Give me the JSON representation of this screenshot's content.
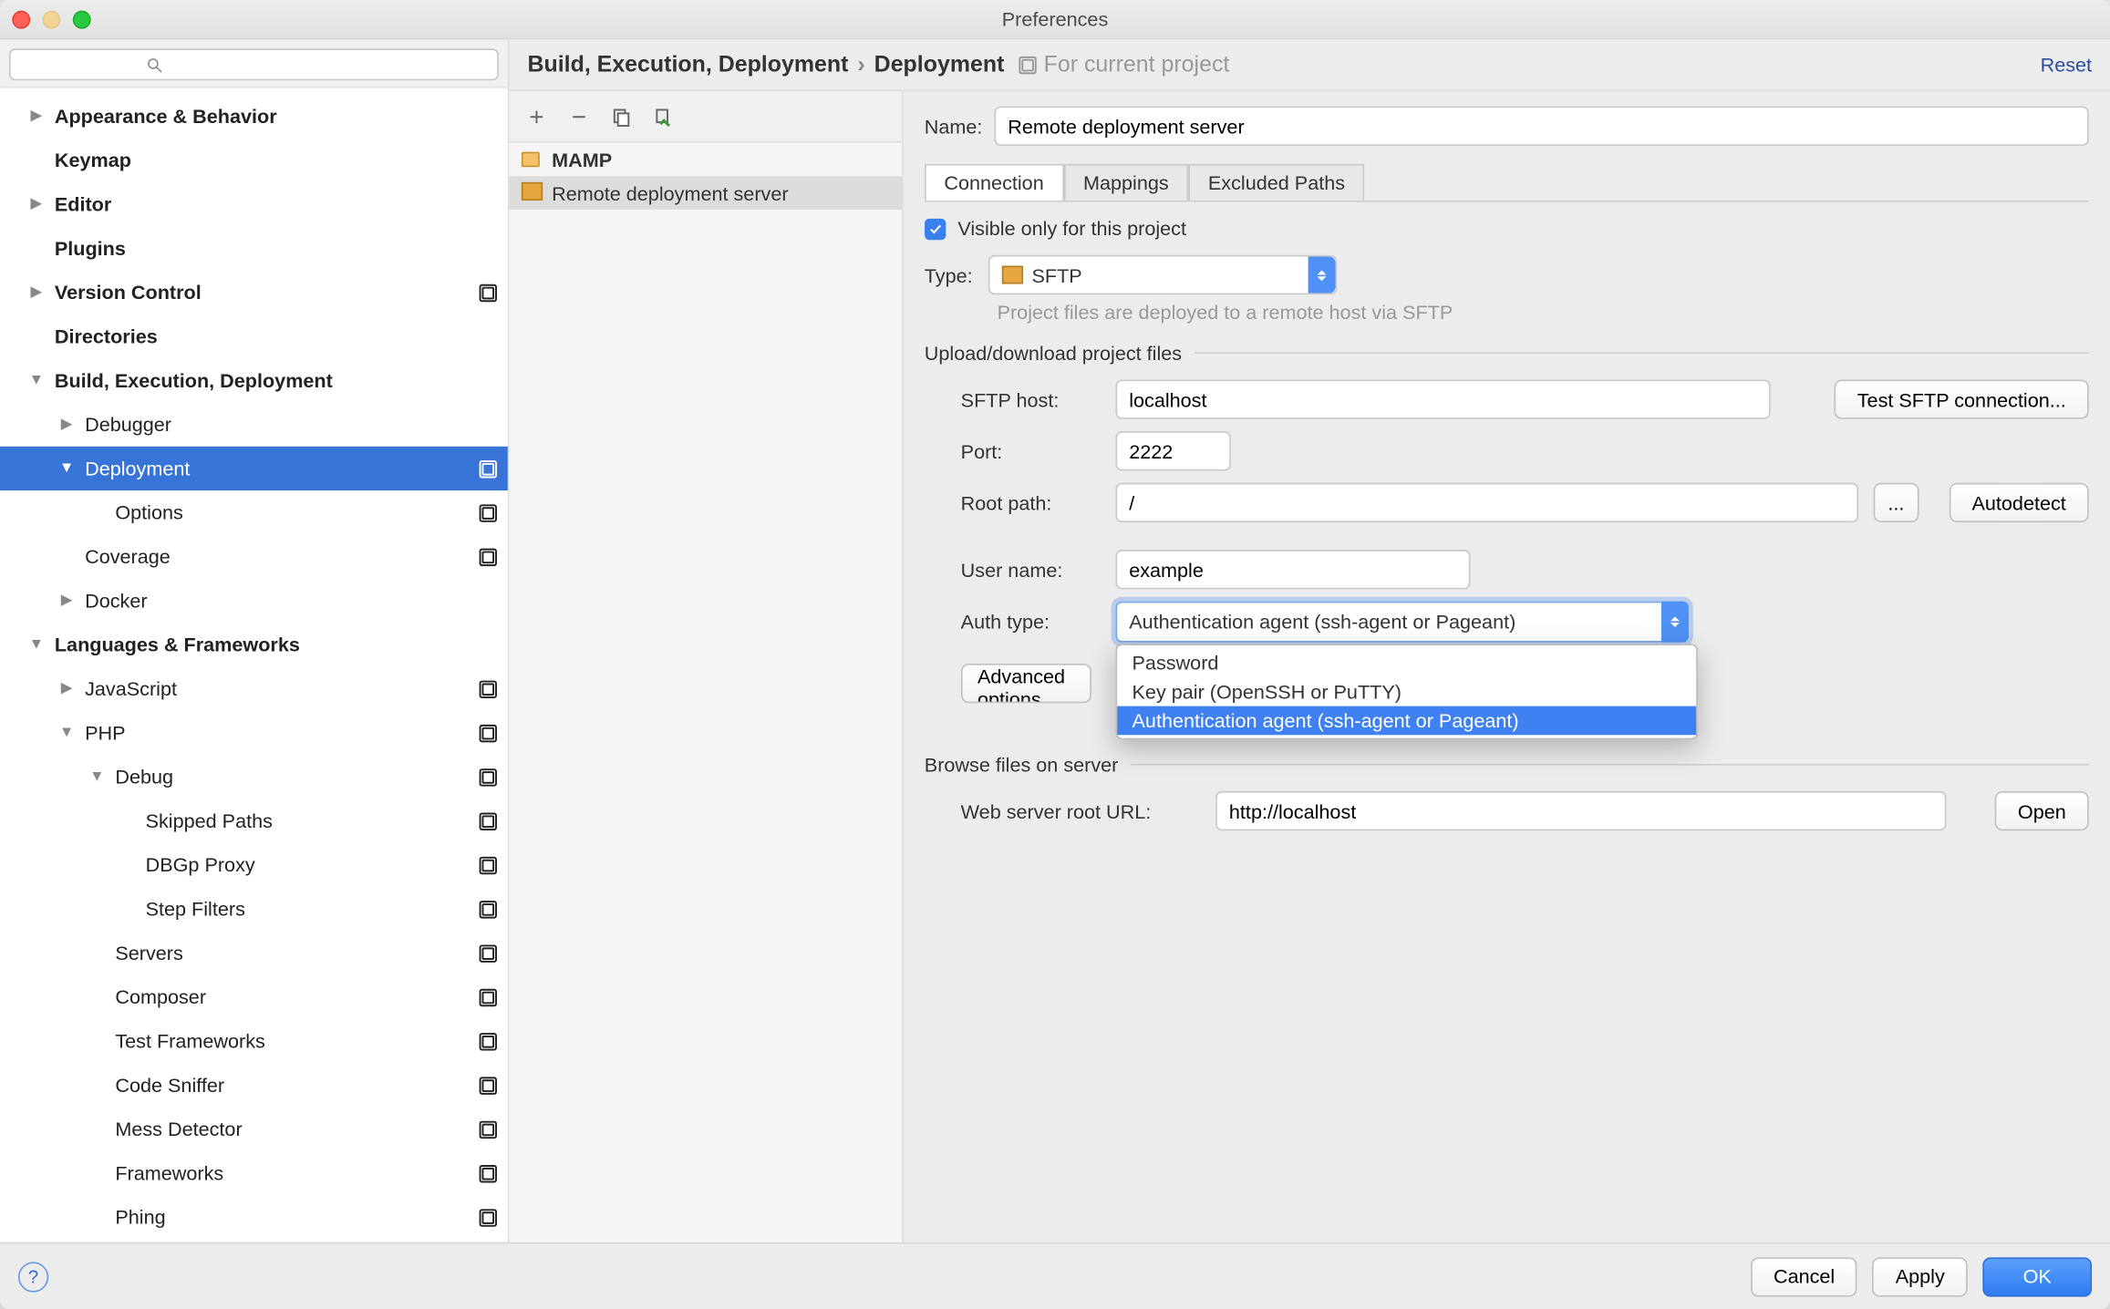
{
  "window": {
    "title": "Preferences"
  },
  "search": {
    "placeholder": ""
  },
  "breadcrumb": {
    "parent": "Build, Execution, Deployment",
    "sep": "›",
    "current": "Deployment",
    "hint": "For current project",
    "reset": "Reset"
  },
  "tree": [
    {
      "label": "Appearance & Behavior",
      "bold": true,
      "arrow": "right",
      "pad": 0
    },
    {
      "label": "Keymap",
      "bold": true,
      "pad": 0
    },
    {
      "label": "Editor",
      "bold": true,
      "arrow": "right",
      "pad": 0
    },
    {
      "label": "Plugins",
      "bold": true,
      "pad": 0
    },
    {
      "label": "Version Control",
      "bold": true,
      "arrow": "right",
      "pad": 0,
      "proj": true
    },
    {
      "label": "Directories",
      "bold": true,
      "pad": 0
    },
    {
      "label": "Build, Execution, Deployment",
      "bold": true,
      "arrow": "down",
      "pad": 0
    },
    {
      "label": "Debugger",
      "arrow": "right",
      "pad": 1
    },
    {
      "label": "Deployment",
      "arrow": "down",
      "pad": 1,
      "selected": true,
      "proj": true
    },
    {
      "label": "Options",
      "pad": 2,
      "proj": true
    },
    {
      "label": "Coverage",
      "pad": 1,
      "proj": true
    },
    {
      "label": "Docker",
      "arrow": "right",
      "pad": 1
    },
    {
      "label": "Languages & Frameworks",
      "bold": true,
      "arrow": "down",
      "pad": 0
    },
    {
      "label": "JavaScript",
      "arrow": "right",
      "pad": 1,
      "proj": true
    },
    {
      "label": "PHP",
      "arrow": "down",
      "pad": 1,
      "proj": true
    },
    {
      "label": "Debug",
      "arrow": "down",
      "pad": 2,
      "proj": true
    },
    {
      "label": "Skipped Paths",
      "pad": 3,
      "proj": true
    },
    {
      "label": "DBGp Proxy",
      "pad": 3,
      "proj": true
    },
    {
      "label": "Step Filters",
      "pad": 3,
      "proj": true
    },
    {
      "label": "Servers",
      "pad": 2,
      "proj": true
    },
    {
      "label": "Composer",
      "pad": 2,
      "proj": true
    },
    {
      "label": "Test Frameworks",
      "pad": 2,
      "proj": true
    },
    {
      "label": "Code Sniffer",
      "pad": 2,
      "proj": true
    },
    {
      "label": "Mess Detector",
      "pad": 2,
      "proj": true
    },
    {
      "label": "Frameworks",
      "pad": 2,
      "proj": true
    },
    {
      "label": "Phing",
      "pad": 2,
      "proj": true
    }
  ],
  "servers": [
    {
      "label": "MAMP",
      "icon": "local",
      "bold": true
    },
    {
      "label": "Remote deployment server",
      "icon": "sftp",
      "selected": true
    }
  ],
  "form": {
    "name_label": "Name:",
    "name_value": "Remote deployment server",
    "tabs": [
      "Connection",
      "Mappings",
      "Excluded Paths"
    ],
    "active_tab": 0,
    "visible_only": "Visible only for this project",
    "type_label": "Type:",
    "type_value": "SFTP",
    "type_help": "Project files are deployed to a remote host via SFTP",
    "upload_group": "Upload/download project files",
    "host_label": "SFTP host:",
    "host_value": "localhost",
    "test_btn": "Test SFTP connection...",
    "port_label": "Port:",
    "port_value": "2222",
    "root_label": "Root path:",
    "root_value": "/",
    "browse_btn": "...",
    "autodetect_btn": "Autodetect",
    "user_label": "User name:",
    "user_value": "example",
    "auth_label": "Auth type:",
    "auth_value": "Authentication agent (ssh-agent or Pageant)",
    "auth_options": [
      "Password",
      "Key pair (OpenSSH or PuTTY)",
      "Authentication agent (ssh-agent or Pageant)"
    ],
    "auth_selected": 2,
    "advanced_btn": "Advanced options...",
    "browse_group": "Browse files on server",
    "url_label": "Web server root URL:",
    "url_value": "http://localhost",
    "open_btn": "Open"
  },
  "footer": {
    "cancel": "Cancel",
    "apply": "Apply",
    "ok": "OK"
  }
}
